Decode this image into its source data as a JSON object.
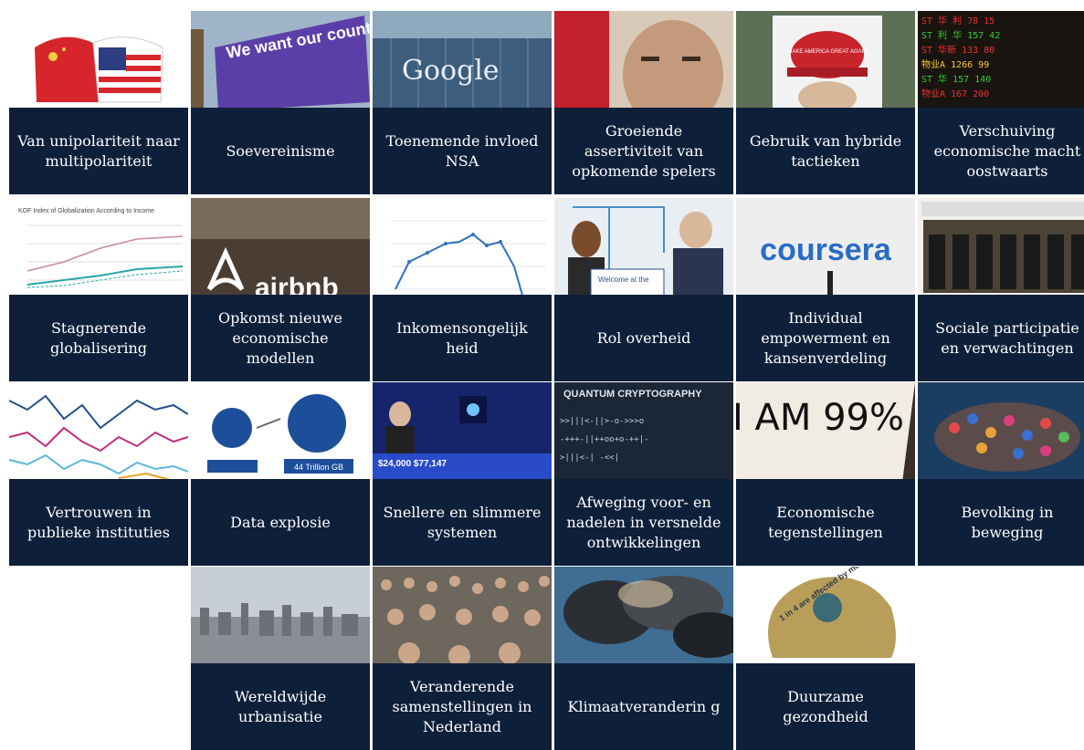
{
  "tiles": [
    {
      "label": "Van unipolariteit naar multipolariteit",
      "image_text": ""
    },
    {
      "label": "Soevereinisme",
      "image_text": "We want our country back Vote to Leave"
    },
    {
      "label": "Toenemende invloed NSA",
      "image_text": "Google"
    },
    {
      "label": "Groeiende assertiviteit van opkomende spelers",
      "image_text": ""
    },
    {
      "label": "Gebruik van hybride tactieken",
      "image_text": "MAKE AMERICA GREAT AGAIN"
    },
    {
      "label": "Verschuiving economische macht oostwaarts",
      "image_text": ""
    },
    {
      "label": "Stagnerende globalisering",
      "image_text": "KOF Index of Globalization According to Income"
    },
    {
      "label": "Opkomst nieuwe economische modellen",
      "image_text": "airbnb"
    },
    {
      "label": "Inkomensongelijk heid",
      "image_text": ""
    },
    {
      "label": "Rol overheid",
      "image_text": "Welcome at the"
    },
    {
      "label": "Individual empowerment en kansenverdeling",
      "image_text": "coursera"
    },
    {
      "label": "Sociale participatie en verwachtingen",
      "image_text": ""
    },
    {
      "label": "Vertrouwen in publieke instituties",
      "image_text": ""
    },
    {
      "label": "Data explosie",
      "image_text": "44 Trillion GB"
    },
    {
      "label": "Snellere en slimmere systemen",
      "image_text": "$24,000 $77,147"
    },
    {
      "label": "Afweging voor- en nadelen in versnelde ontwikkelingen",
      "image_text": "QUANTUM CRYPTOGRAPHY"
    },
    {
      "label": "Economische tegenstellingen",
      "image_text": "I AM 99%"
    },
    {
      "label": "Bevolking in beweging",
      "image_text": ""
    },
    {
      "label": "Wereldwijde urbanisatie",
      "image_text": ""
    },
    {
      "label": "Veranderende samenstellingen in Nederland",
      "image_text": ""
    },
    {
      "label": "Klimaatveranderin g",
      "image_text": ""
    },
    {
      "label": "Duurzame gezondheid",
      "image_text": "1 in 4 are affected by mental illness"
    }
  ]
}
